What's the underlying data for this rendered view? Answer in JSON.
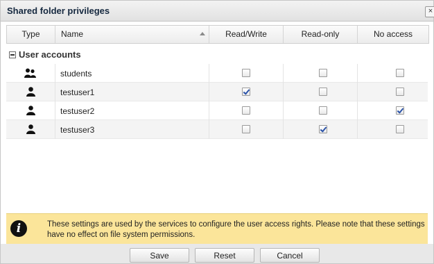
{
  "dialog": {
    "title": "Shared folder privileges",
    "close_icon": "close-icon",
    "close_glyph": "×"
  },
  "columns": {
    "type": "Type",
    "name": "Name",
    "read_write": "Read/Write",
    "read_only": "Read-only",
    "no_access": "No access"
  },
  "group": {
    "label": "User accounts"
  },
  "rows": [
    {
      "icon": "group-icon",
      "name": "students",
      "read_write": false,
      "read_only": false,
      "no_access": false
    },
    {
      "icon": "user-icon",
      "name": "testuser1",
      "read_write": true,
      "read_only": false,
      "no_access": false
    },
    {
      "icon": "user-icon",
      "name": "testuser2",
      "read_write": false,
      "read_only": false,
      "no_access": true
    },
    {
      "icon": "user-icon",
      "name": "testuser3",
      "read_write": false,
      "read_only": true,
      "no_access": false
    }
  ],
  "info": {
    "icon": "info-icon",
    "icon_glyph": "i",
    "text": "These settings are used by the services to configure the user access rights. Please note that these settings have no effect on file system permissions."
  },
  "buttons": {
    "save": "Save",
    "reset": "Reset",
    "cancel": "Cancel"
  },
  "colors": {
    "info_background": "#fbe59a",
    "check_color": "#2a52a8",
    "title_color": "#15283f"
  }
}
